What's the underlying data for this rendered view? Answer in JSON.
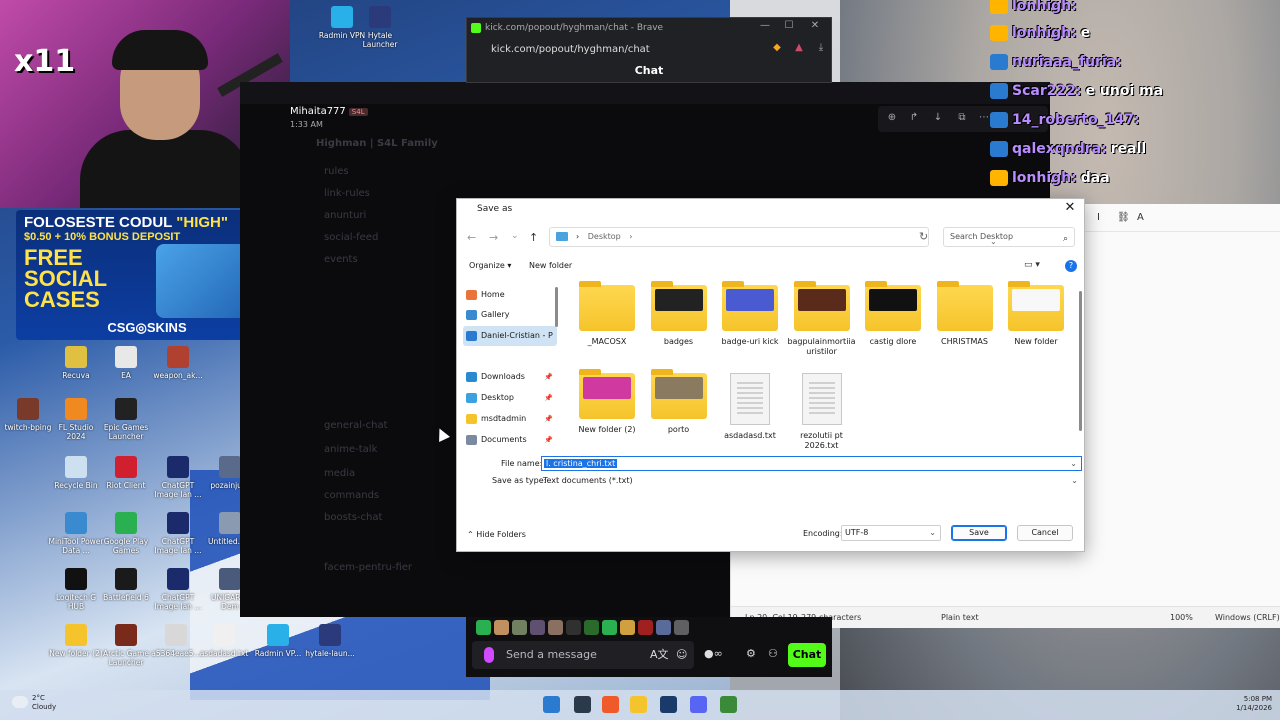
{
  "webcam": {
    "combo_badge": "x11"
  },
  "ad": {
    "line1_prefix": "FOLOSESTE CODUL",
    "line1_code": "\"HIGH\"",
    "line2": "$0.50 + 10% BONUS DEPOSIT",
    "big1": "FREE",
    "big2": "SOCIAL",
    "big3": "CASES",
    "brand": "CSG◎SKINS"
  },
  "desktop_icons": [
    {
      "label": "Radmin VPN",
      "color": "#2ab0e8"
    },
    {
      "label": "Hytale Launcher",
      "color": "#2a3a7a"
    },
    {
      "label": "Recuva",
      "color": "#e0c040"
    },
    {
      "label": "EA",
      "color": "#e8e8e8"
    },
    {
      "label": "weapon_ak...",
      "color": "#b04030"
    },
    {
      "label": "twitch-bping",
      "color": "#7a3a2a"
    },
    {
      "label": "FL Studio 2024",
      "color": "#f08a20"
    },
    {
      "label": "Epic Games Launcher",
      "color": "#222222"
    },
    {
      "label": "Recycle Bin",
      "color": "#cde0f0"
    },
    {
      "label": "Riot Client",
      "color": "#d02030"
    },
    {
      "label": "ChatGPT Image Ian ...",
      "color": "#1a2a6a"
    },
    {
      "label": "pozainjura",
      "color": "#5a6a8a"
    },
    {
      "label": "MiniTool Power Data ...",
      "color": "#3a8ad0"
    },
    {
      "label": "Google Play Games",
      "color": "#2ab050"
    },
    {
      "label": "ChatGPT Image Ian ...",
      "color": "#1a2a6a"
    },
    {
      "label": "Untitled.p...",
      "color": "#8a9ab0"
    },
    {
      "label": "Logitech G HUB",
      "color": "#111111"
    },
    {
      "label": "Battlefield 6",
      "color": "#1a1a1a"
    },
    {
      "label": "ChatGPT Image Ian ...",
      "color": "#1a2a6a"
    },
    {
      "label": "UNIGARI ? Dem",
      "color": "#4a5a7a"
    },
    {
      "label": "New folder (2)",
      "color": "#f5c42c"
    },
    {
      "label": "Arctic Game Launcher",
      "color": "#7a2a1a"
    },
    {
      "label": "a5364eae5...",
      "color": "#d8d8d8"
    },
    {
      "label": "asdadasd.txt",
      "color": "#f0f0f0"
    },
    {
      "label": "Radmin VP...",
      "color": "#2ab0e8"
    },
    {
      "label": "hytale-laun...",
      "color": "#2a3a7a"
    }
  ],
  "overlay_chat": [
    {
      "user": "lonhigh:",
      "msg": "",
      "badge": "#ffb400"
    },
    {
      "user": "lonhigh:",
      "msg": "e",
      "badge": "#ffb400"
    },
    {
      "user": "nuriaaa_furia:",
      "msg": "",
      "badge": "#2a7ad0"
    },
    {
      "user": "Scar222:",
      "msg": "e unoi ma",
      "badge": "#2a7ad0"
    },
    {
      "user": "14_roberto_147:",
      "msg": "",
      "badge": "#2a7ad0"
    },
    {
      "user": "qalexqndra:",
      "msg": "reall",
      "badge": "#2a7ad0"
    },
    {
      "user": "lonhigh:",
      "msg": "daa",
      "badge": "#ffb400"
    }
  ],
  "dark_window": {
    "username": "Mihaita777",
    "user_tag": "S4L",
    "time": "1:33 AM",
    "server_name": "Highman | S4L Family",
    "channels": [
      "rules",
      "link-rules",
      "anunturi",
      "social-feed",
      "events",
      "general-chat",
      "anime-talk",
      "media",
      "commands",
      "boosts-chat",
      "facem-pentru-fier"
    ]
  },
  "brave": {
    "title": "kick.com/popout/hyghman/chat - Brave",
    "url": "kick.com/popout/hyghman/chat",
    "header": "Chat"
  },
  "kick_bottom": {
    "placeholder": "Send a message",
    "chat_button": "Chat",
    "emote_colors": [
      "#2ab050",
      "#c09060",
      "#708060",
      "#605070",
      "#8a7060",
      "#303030",
      "#2a6a2a",
      "#2ab050",
      "#d0a040",
      "#a02020",
      "#5a6a9a",
      "#606060"
    ]
  },
  "notepad": {
    "status_pos": "Ln 20, Col 19",
    "status_chars": "279 characters",
    "status_type": "Plain text",
    "status_zoom": "100%",
    "status_eol": "Windows (CRLF)"
  },
  "dialog": {
    "title": "Save as",
    "address_folder": "Desktop",
    "search_placeholder": "Search Desktop",
    "organize": "Organize",
    "new_folder": "New folder",
    "nav_items": [
      {
        "label": "Home",
        "icon_color": "#e8743b",
        "pinned": false
      },
      {
        "label": "Gallery",
        "icon_color": "#3a8ad0",
        "pinned": false
      },
      {
        "label": "Daniel-Cristian - P",
        "icon_color": "#2a7ad0",
        "pinned": false,
        "selected": true
      },
      {
        "label": "Downloads",
        "icon_color": "#2a8ad0",
        "pinned": true
      },
      {
        "label": "Desktop",
        "icon_color": "#3aa3df",
        "pinned": true
      },
      {
        "label": "msdtadmin",
        "icon_color": "#f5c42c",
        "pinned": true
      },
      {
        "label": "Documents",
        "icon_color": "#7a8aa0",
        "pinned": true
      }
    ],
    "files": [
      {
        "name": "_MACOSX",
        "kind": "folder",
        "pic": ""
      },
      {
        "name": "badges",
        "kind": "folder",
        "pic": "#222222"
      },
      {
        "name": "badge-uri kick",
        "kind": "folder",
        "pic": "#4a5ad0"
      },
      {
        "name": "bagpulainmortiia uristilor",
        "kind": "folder",
        "pic": "#5a2a1a"
      },
      {
        "name": "castig dlore",
        "kind": "folder",
        "pic": "#111111"
      },
      {
        "name": "CHRISTMAS",
        "kind": "folder",
        "pic": ""
      },
      {
        "name": "New folder",
        "kind": "folder",
        "pic": "#f8f8f8"
      },
      {
        "name": "New folder (2)",
        "kind": "folder",
        "pic": "#d03aa0"
      },
      {
        "name": "porto",
        "kind": "folder",
        "pic": "#8a7a60"
      },
      {
        "name": "asdadasd.txt",
        "kind": "doc",
        "pic": ""
      },
      {
        "name": "rezolutii pt 2026.txt",
        "kind": "doc",
        "pic": ""
      }
    ],
    "file_name_label": "File name:",
    "file_name_value": "l. cristina_chri.txt",
    "save_type_label": "Save as type:",
    "save_type_value": "Text documents (*.txt)",
    "hide_folders": "Hide Folders",
    "encoding_label": "Encoding:",
    "encoding_value": "UTF-8",
    "save": "Save",
    "cancel": "Cancel"
  },
  "taskbar": {
    "weather_temp": "2°C",
    "weather_desc": "Cloudy",
    "time": "5:08 PM",
    "date": "1/14/2026",
    "app_colors": [
      "#2a7ad0",
      "#2a3a4a",
      "#f05a2a",
      "#f5c42c",
      "#1a3a6a",
      "#5865f2",
      "#3a8a3a",
      "#2a6ad0"
    ]
  }
}
